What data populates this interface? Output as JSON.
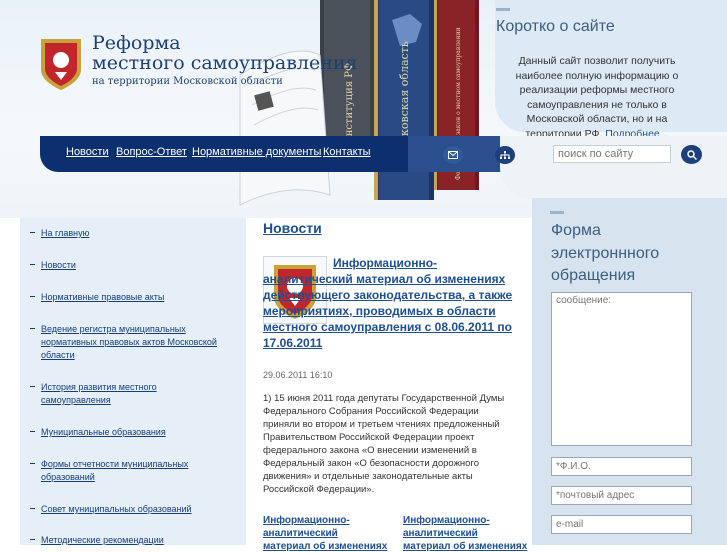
{
  "site": {
    "title_line1": "Реформа",
    "title_line2": "местного самоуправления",
    "title_line3": "на территории Московской области"
  },
  "book_titles": [
    "Конституция РФ",
    "Московская область",
    "Федеральный закон о местном самоуправлении"
  ],
  "nav": {
    "items": [
      "Новости",
      "Вопрос-Ответ",
      "Нормативные документы",
      "Контакты"
    ]
  },
  "toolbar": {
    "mail_icon": "mail-icon",
    "sitemap_icon": "sitemap-icon",
    "search_placeholder": "поиск по сайту",
    "search_icon": "search-icon"
  },
  "about": {
    "title": "Коротко о сайте",
    "text": "Данный сайт позволит получить наиболее полную информацию о реализации реформы местного самоуправления не только в Московской области, но и на территории РФ.",
    "more_link": "Подробнее..."
  },
  "sidebar": {
    "items": [
      "На главную",
      "Новости",
      "Нормативные правовые акты",
      "Ведение регистра муниципальных нормативных правовых актов Московской области",
      "История развития местного самоуправления",
      "Муниципальные образования",
      "Формы отчетности муниципальных образований",
      "Совет муниципальных образований",
      "Методические рекомендации"
    ]
  },
  "news": {
    "section_title": "Новости",
    "headline": "Информационно-аналитический материал об изменениях действующего законодательства, а также мероприятиях, проводимых в области местного самоуправления с 08.06.2011 по 17.06.2011",
    "date": "29.06.2011 16:10",
    "body": "1) 15 июня 2011 года депутаты Государственной Думы Федерального Собрания Российской Федерации приняли во втором и третьем чтениях предложенный Правительством Российской Федерации проект федерального закона «О внесении изменений в Федеральный закон «О безопасности дорожного движения» и отдельные законодательные акты Российской Федерации».",
    "more_items": [
      "Информационно-аналитический материал об изменениях",
      "Информационно-аналитический материал об изменениях"
    ]
  },
  "form": {
    "title": "Форма электроннного обращения",
    "message_placeholder": "сообщение:",
    "name_placeholder": "*Ф.И.О.",
    "address_placeholder": "*почтовый адрес",
    "email_placeholder": "e-mail"
  },
  "colors": {
    "nav_bg": "#0c2f6e",
    "link": "#1d4f91",
    "sidebar_bg": "#e6eff7",
    "form_bg": "#d7e4f0"
  }
}
